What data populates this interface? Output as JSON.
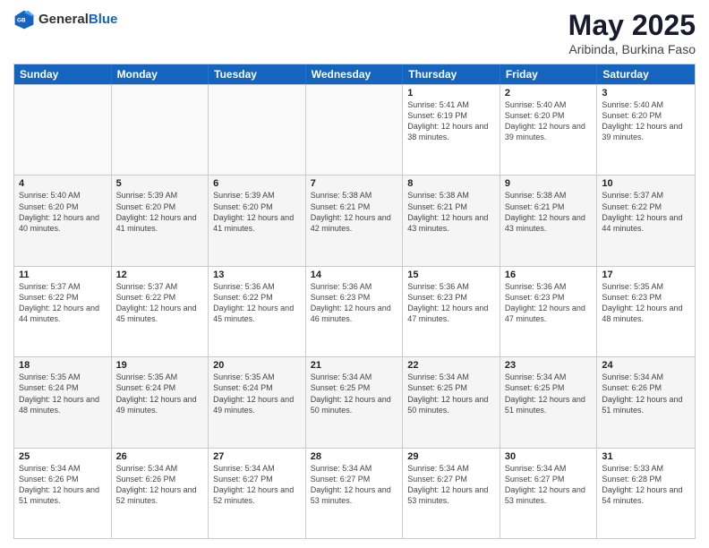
{
  "header": {
    "logo_general": "General",
    "logo_blue": "Blue",
    "month": "May 2025",
    "location": "Aribinda, Burkina Faso"
  },
  "days": [
    "Sunday",
    "Monday",
    "Tuesday",
    "Wednesday",
    "Thursday",
    "Friday",
    "Saturday"
  ],
  "rows": [
    [
      {
        "day": "",
        "info": "",
        "empty": true
      },
      {
        "day": "",
        "info": "",
        "empty": true
      },
      {
        "day": "",
        "info": "",
        "empty": true
      },
      {
        "day": "",
        "info": "",
        "empty": true
      },
      {
        "day": "1",
        "info": "Sunrise: 5:41 AM\nSunset: 6:19 PM\nDaylight: 12 hours\nand 38 minutes."
      },
      {
        "day": "2",
        "info": "Sunrise: 5:40 AM\nSunset: 6:20 PM\nDaylight: 12 hours\nand 39 minutes."
      },
      {
        "day": "3",
        "info": "Sunrise: 5:40 AM\nSunset: 6:20 PM\nDaylight: 12 hours\nand 39 minutes."
      }
    ],
    [
      {
        "day": "4",
        "info": "Sunrise: 5:40 AM\nSunset: 6:20 PM\nDaylight: 12 hours\nand 40 minutes."
      },
      {
        "day": "5",
        "info": "Sunrise: 5:39 AM\nSunset: 6:20 PM\nDaylight: 12 hours\nand 41 minutes."
      },
      {
        "day": "6",
        "info": "Sunrise: 5:39 AM\nSunset: 6:20 PM\nDaylight: 12 hours\nand 41 minutes."
      },
      {
        "day": "7",
        "info": "Sunrise: 5:38 AM\nSunset: 6:21 PM\nDaylight: 12 hours\nand 42 minutes."
      },
      {
        "day": "8",
        "info": "Sunrise: 5:38 AM\nSunset: 6:21 PM\nDaylight: 12 hours\nand 43 minutes."
      },
      {
        "day": "9",
        "info": "Sunrise: 5:38 AM\nSunset: 6:21 PM\nDaylight: 12 hours\nand 43 minutes."
      },
      {
        "day": "10",
        "info": "Sunrise: 5:37 AM\nSunset: 6:22 PM\nDaylight: 12 hours\nand 44 minutes."
      }
    ],
    [
      {
        "day": "11",
        "info": "Sunrise: 5:37 AM\nSunset: 6:22 PM\nDaylight: 12 hours\nand 44 minutes."
      },
      {
        "day": "12",
        "info": "Sunrise: 5:37 AM\nSunset: 6:22 PM\nDaylight: 12 hours\nand 45 minutes."
      },
      {
        "day": "13",
        "info": "Sunrise: 5:36 AM\nSunset: 6:22 PM\nDaylight: 12 hours\nand 45 minutes."
      },
      {
        "day": "14",
        "info": "Sunrise: 5:36 AM\nSunset: 6:23 PM\nDaylight: 12 hours\nand 46 minutes."
      },
      {
        "day": "15",
        "info": "Sunrise: 5:36 AM\nSunset: 6:23 PM\nDaylight: 12 hours\nand 47 minutes."
      },
      {
        "day": "16",
        "info": "Sunrise: 5:36 AM\nSunset: 6:23 PM\nDaylight: 12 hours\nand 47 minutes."
      },
      {
        "day": "17",
        "info": "Sunrise: 5:35 AM\nSunset: 6:23 PM\nDaylight: 12 hours\nand 48 minutes."
      }
    ],
    [
      {
        "day": "18",
        "info": "Sunrise: 5:35 AM\nSunset: 6:24 PM\nDaylight: 12 hours\nand 48 minutes."
      },
      {
        "day": "19",
        "info": "Sunrise: 5:35 AM\nSunset: 6:24 PM\nDaylight: 12 hours\nand 49 minutes."
      },
      {
        "day": "20",
        "info": "Sunrise: 5:35 AM\nSunset: 6:24 PM\nDaylight: 12 hours\nand 49 minutes."
      },
      {
        "day": "21",
        "info": "Sunrise: 5:34 AM\nSunset: 6:25 PM\nDaylight: 12 hours\nand 50 minutes."
      },
      {
        "day": "22",
        "info": "Sunrise: 5:34 AM\nSunset: 6:25 PM\nDaylight: 12 hours\nand 50 minutes."
      },
      {
        "day": "23",
        "info": "Sunrise: 5:34 AM\nSunset: 6:25 PM\nDaylight: 12 hours\nand 51 minutes."
      },
      {
        "day": "24",
        "info": "Sunrise: 5:34 AM\nSunset: 6:26 PM\nDaylight: 12 hours\nand 51 minutes."
      }
    ],
    [
      {
        "day": "25",
        "info": "Sunrise: 5:34 AM\nSunset: 6:26 PM\nDaylight: 12 hours\nand 51 minutes."
      },
      {
        "day": "26",
        "info": "Sunrise: 5:34 AM\nSunset: 6:26 PM\nDaylight: 12 hours\nand 52 minutes."
      },
      {
        "day": "27",
        "info": "Sunrise: 5:34 AM\nSunset: 6:27 PM\nDaylight: 12 hours\nand 52 minutes."
      },
      {
        "day": "28",
        "info": "Sunrise: 5:34 AM\nSunset: 6:27 PM\nDaylight: 12 hours\nand 53 minutes."
      },
      {
        "day": "29",
        "info": "Sunrise: 5:34 AM\nSunset: 6:27 PM\nDaylight: 12 hours\nand 53 minutes."
      },
      {
        "day": "30",
        "info": "Sunrise: 5:34 AM\nSunset: 6:27 PM\nDaylight: 12 hours\nand 53 minutes."
      },
      {
        "day": "31",
        "info": "Sunrise: 5:33 AM\nSunset: 6:28 PM\nDaylight: 12 hours\nand 54 minutes."
      }
    ]
  ]
}
